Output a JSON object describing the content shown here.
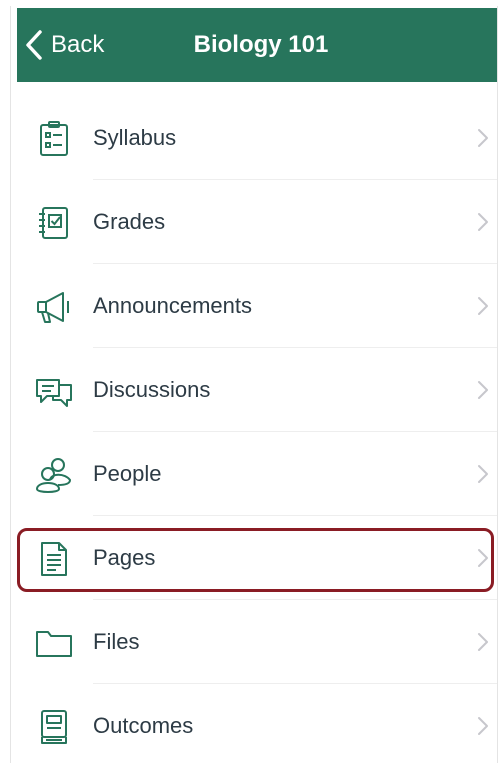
{
  "header": {
    "back_label": "Back",
    "title": "Biology 101",
    "background": "#27755c"
  },
  "menu": {
    "items": [
      {
        "label": "Syllabus",
        "icon": "syllabus-icon"
      },
      {
        "label": "Grades",
        "icon": "grades-icon"
      },
      {
        "label": "Announcements",
        "icon": "announcements-icon"
      },
      {
        "label": "Discussions",
        "icon": "discussions-icon"
      },
      {
        "label": "People",
        "icon": "people-icon"
      },
      {
        "label": "Pages",
        "icon": "pages-icon",
        "highlighted": true
      },
      {
        "label": "Files",
        "icon": "files-icon"
      },
      {
        "label": "Outcomes",
        "icon": "outcomes-icon"
      }
    ],
    "icon_color": "#27755c",
    "highlight_color": "#8a1c24"
  }
}
